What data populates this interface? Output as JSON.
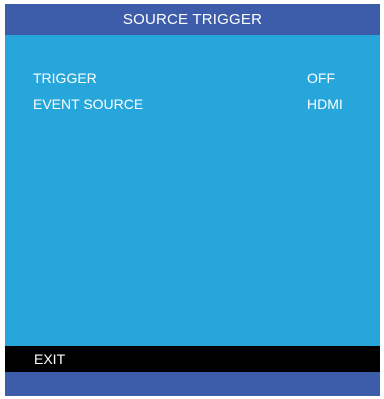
{
  "menu": {
    "title": "SOURCE TRIGGER",
    "items": [
      {
        "label": "TRIGGER",
        "value": "OFF"
      },
      {
        "label": "EVENT SOURCE",
        "value": "HDMI"
      }
    ],
    "exit_label": "EXIT"
  },
  "colors": {
    "title_bar": "#3d5daa",
    "content_bg": "#27a6dc",
    "exit_bar": "#000000",
    "footer_bar": "#3d5daa",
    "text": "#ffffff"
  }
}
